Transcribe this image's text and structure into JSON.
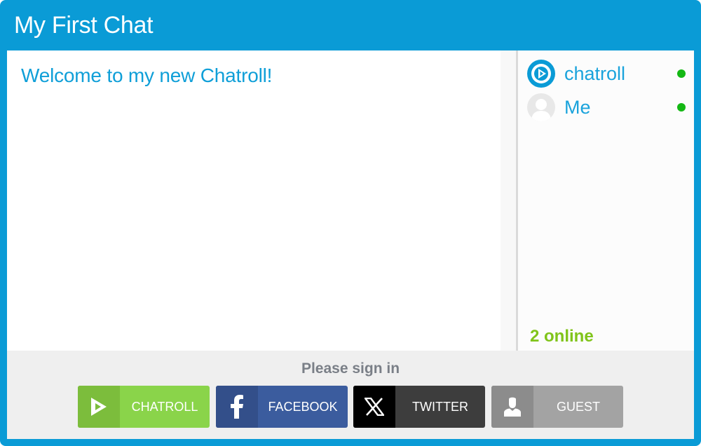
{
  "header": {
    "title": "My First Chat"
  },
  "messages": [
    {
      "text": "Welcome to my new Chatroll!"
    }
  ],
  "users": [
    {
      "name": "chatroll",
      "avatar": "chatroll-logo-icon",
      "status": "online"
    },
    {
      "name": "Me",
      "avatar": "default-user-avatar-icon",
      "status": "online"
    }
  ],
  "online_count": "2 online",
  "signin": {
    "label": "Please sign in",
    "buttons": [
      {
        "label": "CHATROLL",
        "icon": "chatroll-logo-icon"
      },
      {
        "label": "FACEBOOK",
        "icon": "facebook-icon"
      },
      {
        "label": "TWITTER",
        "icon": "x-logo-icon"
      },
      {
        "label": "GUEST",
        "icon": "person-icon"
      }
    ]
  },
  "colors": {
    "brand_blue": "#0a9bd6",
    "online_green": "#14b814",
    "online_count_green": "#80c41a",
    "chatroll_green": "#8ad44a",
    "facebook_blue": "#3b5c9e",
    "twitter_dark": "#3d3d3d",
    "guest_gray": "#a3a3a3"
  }
}
